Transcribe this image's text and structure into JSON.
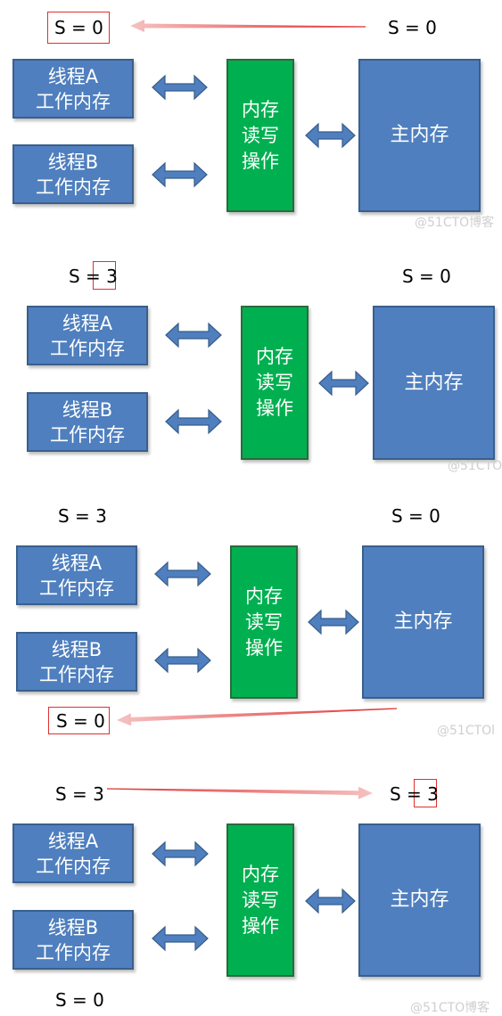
{
  "colors": {
    "thread_box": "#4f7fbe",
    "memory_ops_box": "#00b050",
    "main_memory_box": "#4f7fbe",
    "highlight_border": "#e03030",
    "sync_arrow": "#e03030",
    "double_arrow": "#4f7fbe"
  },
  "labels": {
    "thread_a": "线程A",
    "thread_b": "线程B",
    "work_memory": "工作内存",
    "mem_ops_1": "内存",
    "mem_ops_2": "读写",
    "mem_ops_3": "操作",
    "main_memory": "主内存",
    "s_prefix": "S ="
  },
  "panels": [
    {
      "top_value": "0",
      "main_value": "0",
      "bottom_value": "",
      "watermark": "@51CTO博客"
    },
    {
      "top_value": "3",
      "main_value": "0",
      "bottom_value": "",
      "watermark": "@51CTO"
    },
    {
      "top_value": "3",
      "main_value": "0",
      "bottom_value": "0",
      "watermark": "@51CTOl"
    },
    {
      "top_value": "3",
      "main_value": "3",
      "bottom_value": "0",
      "watermark": "@51CTO博客"
    }
  ]
}
